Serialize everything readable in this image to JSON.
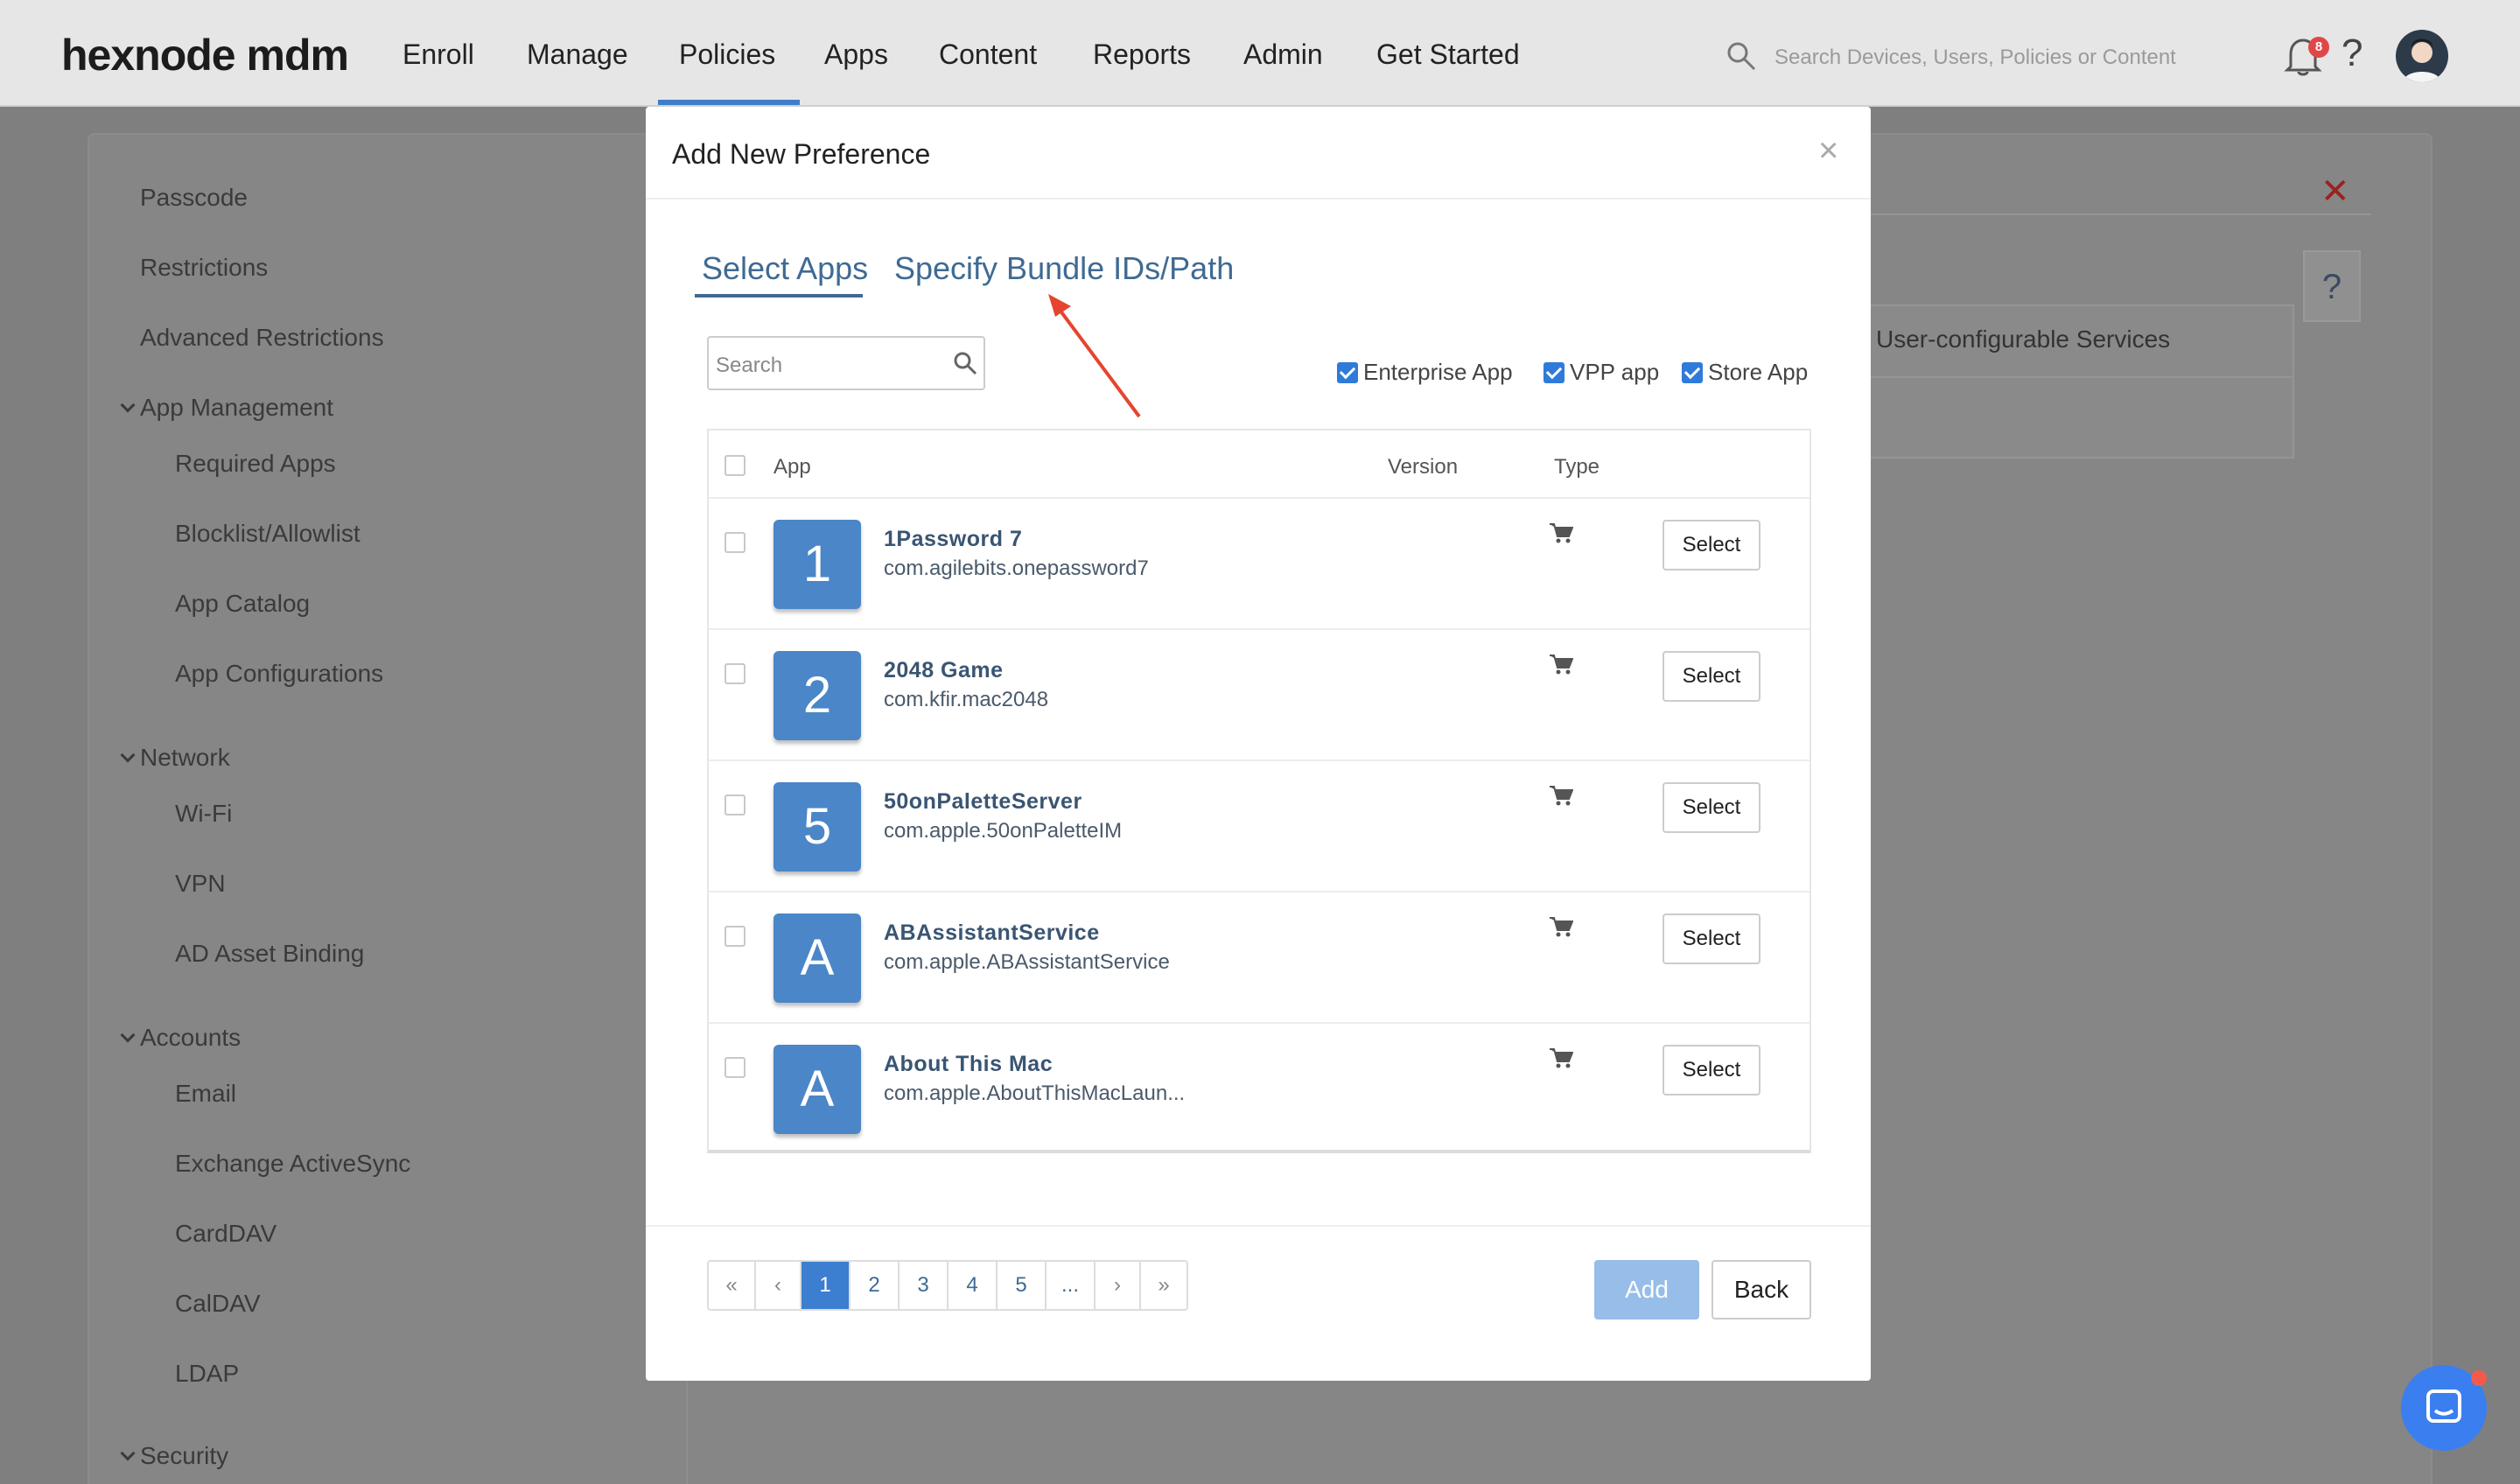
{
  "topnav": {
    "logo": "hexnode mdm",
    "items": [
      "Enroll",
      "Manage",
      "Policies",
      "Apps",
      "Content",
      "Reports",
      "Admin",
      "Get Started"
    ],
    "active": "Policies",
    "search_placeholder": "Search Devices, Users, Policies or Content",
    "notification_count": "8",
    "help": "?"
  },
  "sidebar": {
    "items": [
      {
        "label": "Passcode"
      },
      {
        "label": "Restrictions"
      },
      {
        "label": "Advanced Restrictions"
      },
      {
        "label": "App Management",
        "group": true
      },
      {
        "label": "Required Apps"
      },
      {
        "label": "Blocklist/Allowlist"
      },
      {
        "label": "App Catalog"
      },
      {
        "label": "App Configurations"
      },
      {
        "label": "Network",
        "group": true
      },
      {
        "label": "Wi-Fi"
      },
      {
        "label": "VPN"
      },
      {
        "label": "AD Asset Binding"
      },
      {
        "label": "Accounts",
        "group": true
      },
      {
        "label": "Email"
      },
      {
        "label": "Exchange ActiveSync"
      },
      {
        "label": "CardDAV"
      },
      {
        "label": "CalDAV"
      },
      {
        "label": "LDAP"
      },
      {
        "label": "Security",
        "group": true
      }
    ]
  },
  "background": {
    "close_x": "✕",
    "help": "?",
    "services_label": "User-configurable Services"
  },
  "modal": {
    "title": "Add New Preference",
    "close": "×",
    "tabs": [
      {
        "label": "Select Apps",
        "active": true
      },
      {
        "label": "Specify Bundle IDs/Path",
        "active": false
      }
    ],
    "search_placeholder": "Search",
    "filters": [
      {
        "label": "Enterprise App",
        "checked": true
      },
      {
        "label": "VPP app",
        "checked": true
      },
      {
        "label": "Store App",
        "checked": true
      }
    ],
    "table": {
      "headers": {
        "app": "App",
        "version": "Version",
        "type": "Type"
      },
      "rows": [
        {
          "icon_letter": "1",
          "name": "1Password 7",
          "bundle": "com.agilebits.onepassword7",
          "type_icon": "cart-icon",
          "action": "Select"
        },
        {
          "icon_letter": "2",
          "name": "2048 Game",
          "bundle": "com.kfir.mac2048",
          "type_icon": "cart-icon",
          "action": "Select"
        },
        {
          "icon_letter": "5",
          "name": "50onPaletteServer",
          "bundle": "com.apple.50onPaletteIM",
          "type_icon": "cart-icon",
          "action": "Select"
        },
        {
          "icon_letter": "A",
          "name": "ABAssistantService",
          "bundle": "com.apple.ABAssistantService",
          "type_icon": "cart-icon",
          "action": "Select"
        },
        {
          "icon_letter": "A",
          "name": "About This Mac",
          "bundle": "com.apple.AboutThisMacLaun...",
          "type_icon": "cart-icon",
          "action": "Select"
        }
      ]
    },
    "pagination": [
      "«",
      "‹",
      "1",
      "2",
      "3",
      "4",
      "5",
      "...",
      "›",
      "»"
    ],
    "current_page": "1",
    "add_label": "Add",
    "back_label": "Back"
  },
  "colors": {
    "accent": "#3c7ed0",
    "tab_text": "#3f6a93",
    "app_icon": "#4a86c8",
    "annotation_arrow": "#e5452f"
  }
}
